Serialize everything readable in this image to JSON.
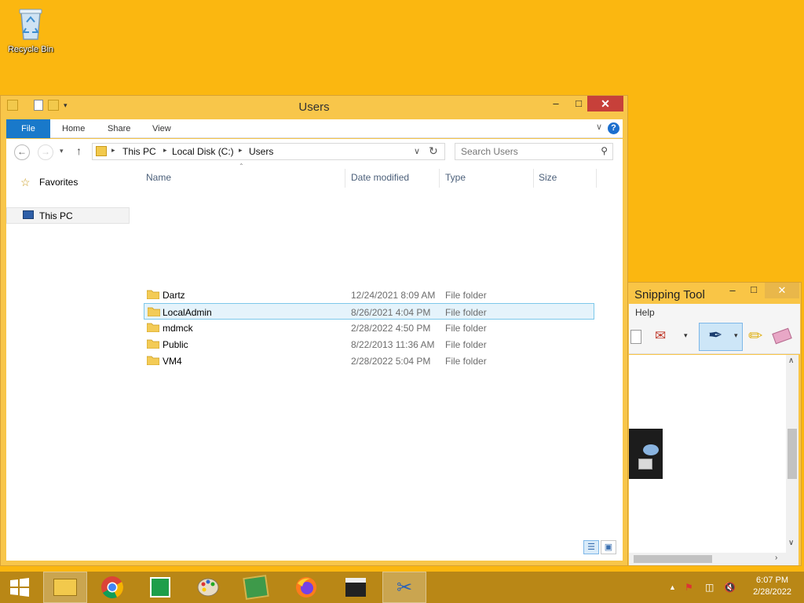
{
  "desktop": {
    "recycle_bin_label": "Recycle Bin"
  },
  "explorer": {
    "title": "Users",
    "window_buttons": {
      "minimize": "–",
      "maximize": "□",
      "close": "✕"
    },
    "ribbon_tabs": [
      "File",
      "Home",
      "Share",
      "View"
    ],
    "help": "?",
    "breadcrumb": [
      "This PC",
      "Local Disk (C:)",
      "Users"
    ],
    "search_placeholder": "Search Users",
    "nav_pane": {
      "favorites": "Favorites",
      "this_pc": "This PC"
    },
    "columns": {
      "name": "Name",
      "date": "Date modified",
      "type": "Type",
      "size": "Size"
    },
    "files": [
      {
        "name": "Dartz",
        "date": "12/24/2021 8:09 AM",
        "type": "File folder"
      },
      {
        "name": "LocalAdmin",
        "date": "8/26/2021 4:04 PM",
        "type": "File folder"
      },
      {
        "name": "mdmck",
        "date": "2/28/2022 4:50 PM",
        "type": "File folder"
      },
      {
        "name": "Public",
        "date": "8/22/2013 11:36 AM",
        "type": "File folder"
      },
      {
        "name": "VM4",
        "date": "2/28/2022 5:04 PM",
        "type": "File folder"
      }
    ],
    "selected_row": "LocalAdmin"
  },
  "snipping_tool": {
    "title": "Snipping Tool",
    "menu_help": "Help",
    "window_buttons": {
      "minimize": "–",
      "maximize": "□",
      "close": "✕"
    }
  },
  "taskbar": {
    "time": "6:07 PM",
    "date": "2/28/2022"
  }
}
